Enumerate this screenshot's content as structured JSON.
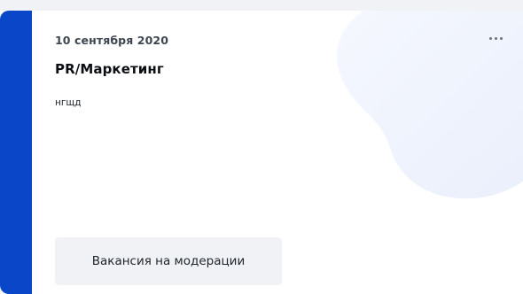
{
  "card": {
    "date": "10 сентября 2020",
    "title": "PR/Маркетинг",
    "description": "нгщд",
    "status_button_label": "Вакансия на модерации",
    "more_icon": "ellipsis-horizontal-icon"
  },
  "colors": {
    "accent": "#0a46c8",
    "card_background": "#ffffff",
    "page_background": "#f1f2f6",
    "blob": "#eef3fd",
    "status_button_background": "#f1f2f6"
  }
}
